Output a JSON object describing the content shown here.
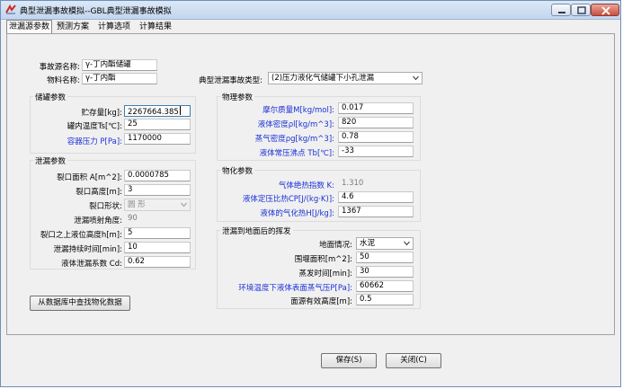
{
  "window": {
    "title": "典型泄漏事故模拟--GBL典型泄漏事故模拟",
    "controls": [
      "minimize",
      "maximize",
      "close"
    ]
  },
  "tabs": [
    {
      "label": "泄漏源参数",
      "active": true
    },
    {
      "label": "预测方案",
      "active": false
    },
    {
      "label": "计算选项",
      "active": false
    },
    {
      "label": "计算结果",
      "active": false
    }
  ],
  "source": {
    "accident_name_label": "事故源名称:",
    "accident_name_value": "γ-丁内酯储罐",
    "material_name_label": "物料名称:",
    "material_name_value": "γ-丁内酯",
    "accident_type_label": "典型泄漏事故类型:",
    "accident_type_value": "(2)压力液化气储罐下小孔泄漏"
  },
  "storage": {
    "title": "储罐参数",
    "amount_label": "贮存量[kg]:",
    "amount_value": "2267664.385",
    "temp_label": "罐内温度Ts[℃]:",
    "temp_value": "25",
    "pressure_label": "容器压力 P[Pa]:",
    "pressure_value": "1170000"
  },
  "leak": {
    "title": "泄漏参数",
    "area_label": "裂口面积 A[m^2]:",
    "area_value": "0.0000785",
    "height_label": "裂口高度[m]:",
    "height_value": "3",
    "shape_label": "裂口形状:",
    "shape_value": "圆  形",
    "angle_label": "泄漏喷射角度:",
    "angle_value": "90",
    "liquid_height_label": "裂口之上液位高度h[m]:",
    "liquid_height_value": "5",
    "duration_label": "泄漏持续时间[min]:",
    "duration_value": "10",
    "coef_label": "液体泄漏系数  Cd:",
    "coef_value": "0.62"
  },
  "physical": {
    "title": "物理参数",
    "molar_label": "摩尔质量M[kg/mol]:",
    "molar_value": "0.017",
    "liquid_density_label": "液体密度ρl[kg/m^3]:",
    "liquid_density_value": "820",
    "vapor_density_label": "蒸气密度ρg[kg/m^3]:",
    "vapor_density_value": "0.78",
    "boiling_label": "液体常压沸点 Tb[℃]:",
    "boiling_value": "-33"
  },
  "chemical": {
    "title": "物化参数",
    "adiabatic_label": "气体绝热指数  K:",
    "adiabatic_value": "1.310",
    "heat_capacity_label": "液体定压比热CP[J/(kg·K)]:",
    "heat_capacity_value": "4.6",
    "vaporization_label": "液体的气化热H[J/kg]:",
    "vaporization_value": "1367"
  },
  "evaporation": {
    "title": "泄漏到地面后的挥发",
    "ground_label": "地面情况:",
    "ground_value": "水泥",
    "area_label": "围堰面积[m^2]:",
    "area_value": "50",
    "time_label": "蒸发时间[min]:",
    "time_value": "30",
    "vapor_pressure_label": "环境温度下液体表面蒸气压P[Pa]:",
    "vapor_pressure_value": "60662",
    "source_height_label": "面源有效高度[m]:",
    "source_height_value": "0.5"
  },
  "buttons": {
    "lookup": "从数据库中查找物化数据",
    "save": "保存(S)",
    "close": "关闭(C)"
  },
  "colors": {
    "blue_label": "#1a2fd6",
    "title_bar": "#c3d6ee"
  }
}
